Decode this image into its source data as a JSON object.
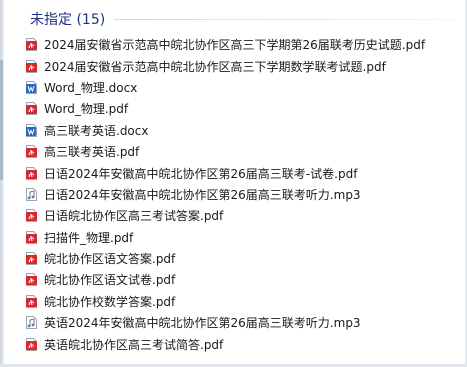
{
  "group": {
    "title": "未指定 (15)"
  },
  "files": [
    {
      "name": "2024届安徽省示范高中皖北协作区高三下学期第26届联考历史试题.pdf",
      "icon": "pdf-icon"
    },
    {
      "name": "2024届安徽省示范高中皖北协作区高三下学期数学联考试题.pdf",
      "icon": "pdf-icon"
    },
    {
      "name": "Word_物理.docx",
      "icon": "word-icon"
    },
    {
      "name": "Word_物理.pdf",
      "icon": "pdf-icon"
    },
    {
      "name": "高三联考英语.docx",
      "icon": "word-icon"
    },
    {
      "name": "高三联考英语.pdf",
      "icon": "pdf-icon"
    },
    {
      "name": "日语2024年安徽高中皖北协作区第26届高三联考-试卷.pdf",
      "icon": "pdf-icon"
    },
    {
      "name": "日语2024年安徽高中皖北协作区第26届高三联考听力.mp3",
      "icon": "audio-icon"
    },
    {
      "name": "日语皖北协作区高三考试答案.pdf",
      "icon": "pdf-icon"
    },
    {
      "name": "扫描件_物理.pdf",
      "icon": "pdf-icon"
    },
    {
      "name": "皖北协作区语文答案.pdf",
      "icon": "pdf-icon"
    },
    {
      "name": "皖北协作区语文试卷.pdf",
      "icon": "pdf-icon"
    },
    {
      "name": "皖北协作校数学答案.pdf",
      "icon": "pdf-icon"
    },
    {
      "name": "英语2024年安徽高中皖北协作区第26届高三联考听力.mp3",
      "icon": "audio-icon"
    },
    {
      "name": "英语皖北协作区高三考试简答.pdf",
      "icon": "pdf-icon"
    }
  ],
  "colors": {
    "header": "#1e3287",
    "pdf": "#d8282b",
    "word": "#2b64c3",
    "audio": "#6b7f96"
  }
}
